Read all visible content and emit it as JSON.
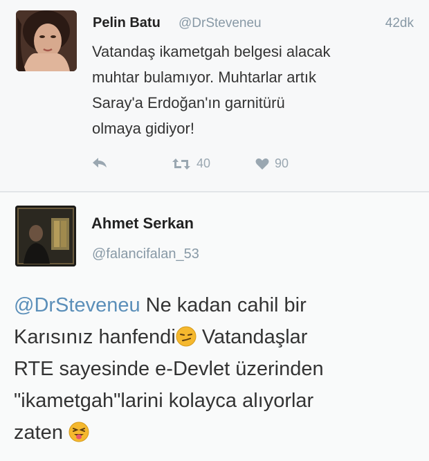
{
  "tweet1": {
    "author_name": "Pelin Batu",
    "handle": "@DrSteveneu",
    "time": "42dk",
    "text_lines": [
      "Vatandaş ikametgah belgesi alacak",
      "muhtar bulamıyor. Muhtarlar artık",
      "Saray'a Erdoğan'ın garnitürü",
      "olmaya gidiyor!"
    ],
    "retweet_count": "40",
    "like_count": "90",
    "icons": {
      "reply": "reply-icon",
      "retweet": "retweet-icon",
      "like": "heart-icon"
    }
  },
  "tweet2": {
    "author_name": "Ahmet Serkan",
    "handle": "@falancifalan_53",
    "mention": "@DrSteveneu",
    "line1_rest": " Ne kadan cahil bir",
    "line2_a": "Karısınız hanfendi",
    "line2_b": " Vatandaşlar",
    "line3": "RTE sayesinde e-Devlet üzerinden",
    "line4": "\"ikametgah\"larini kolayca alıyorlar",
    "line5": "zaten ",
    "emojis": [
      "smirk-emoji",
      "tongue-wink-emoji"
    ]
  },
  "colors": {
    "mention": "#5b8fb9",
    "muted": "#8899a6",
    "emoji_yellow": "#f5b82e"
  }
}
